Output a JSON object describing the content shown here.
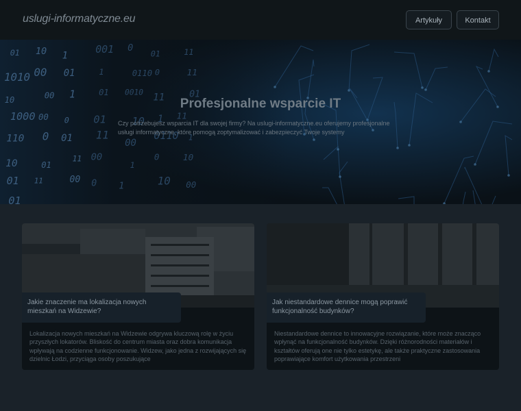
{
  "header": {
    "logo": "uslugi-informatyczne.eu",
    "nav": [
      {
        "label": "Artykuły"
      },
      {
        "label": "Kontakt"
      }
    ]
  },
  "hero": {
    "title": "Profesjonalne wsparcie IT",
    "description": "Czy potrzebujesz wsparcia IT dla swojej firmy? Na uslugi-informatyczne.eu oferujemy profesjonalne usługi informatyczne, które pomogą zoptymalizować i zabezpieczyć Twoje systemy",
    "binary_digits": [
      "01",
      "10",
      "1",
      "001",
      "0",
      "01",
      "11",
      "1010",
      "00",
      "01",
      "1",
      "0110",
      "0",
      "11",
      "10",
      "00",
      "1",
      "01",
      "0010",
      "11",
      "01",
      "1000",
      "00",
      "0",
      "01",
      "10",
      "1",
      "11",
      "110",
      "0",
      "01",
      "11",
      "00",
      "0110",
      "1",
      "10",
      "01",
      "11",
      "00",
      "1",
      "0",
      "10",
      "01",
      "11",
      "00",
      "0",
      "1",
      "10",
      "00",
      "01"
    ]
  },
  "cards": [
    {
      "title": "Jakie znaczenie ma lokalizacja nowych mieszkań na Widzewie?",
      "text": "Lokalizacja nowych mieszkań na Widzewie odgrywa kluczową rolę w życiu przyszłych lokatorów. Bliskość do centrum miasta oraz dobra komunikacja wpływają na codzienne funkcjonowanie. Widzew, jako jedna z rozwijających się dzielnic Łodzi, przyciąga osoby poszukujące"
    },
    {
      "title": "Jak niestandardowe dennice mogą poprawić funkcjonalność budynków?",
      "text": "Niestandardowe dennice to innowacyjne rozwiązanie, które może znacząco wpłynąć na funkcjonalność budynków. Dzięki różnorodności materiałów i kształtów oferują one nie tylko estetykę, ale także praktyczne zastosowania poprawiające komfort użytkowania przestrzeni"
    }
  ],
  "colors": {
    "background": "#1a2229",
    "header": "#101619",
    "card": "#0d1317",
    "circuit": "#2b5a86"
  }
}
